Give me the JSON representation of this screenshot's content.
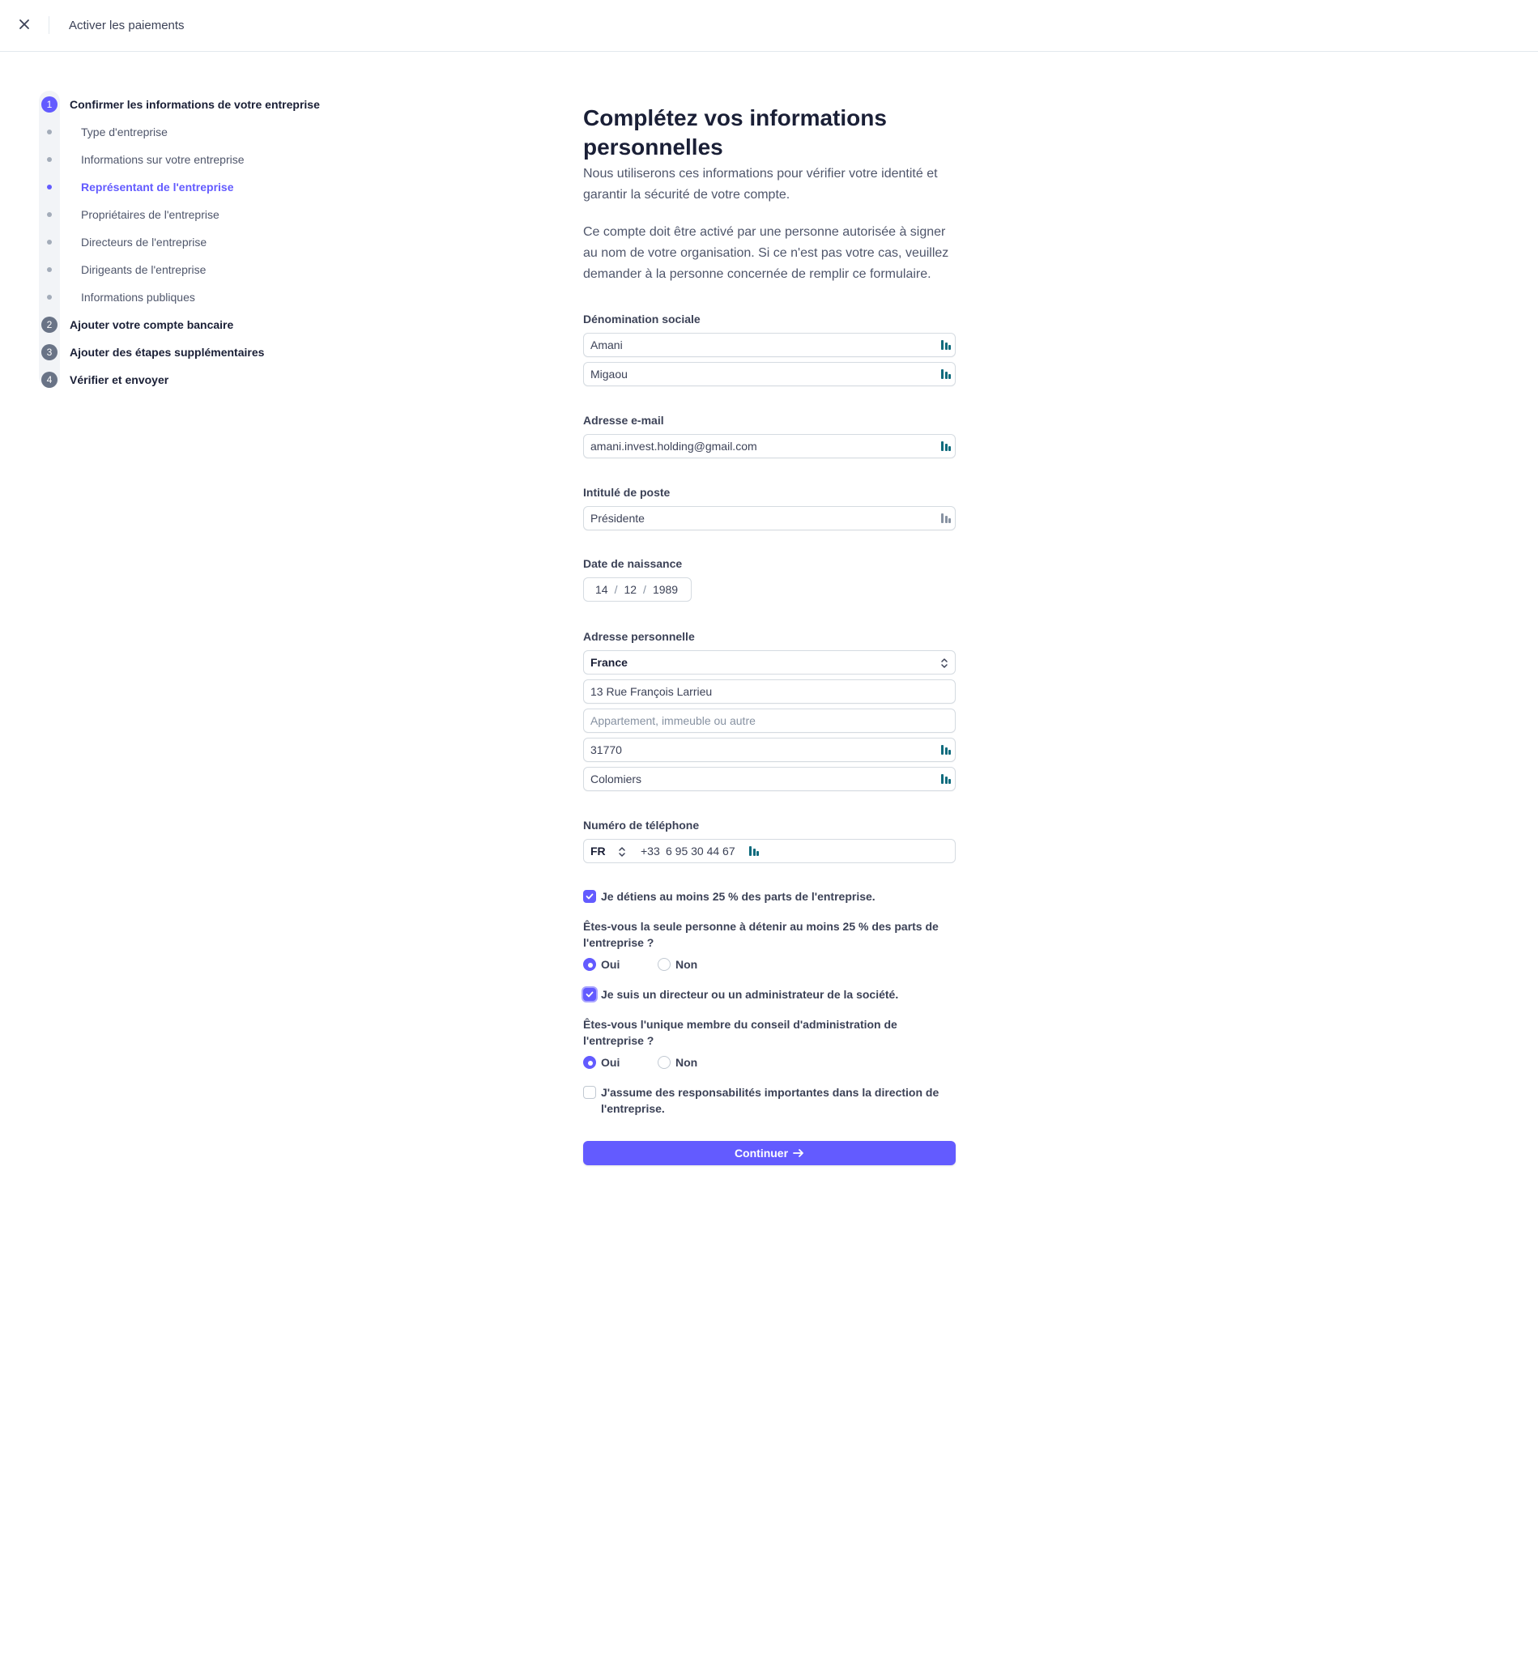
{
  "topbar": {
    "title": "Activer les paiements"
  },
  "stepper": {
    "steps": [
      {
        "num": "1",
        "label": "Confirmer les informations de votre entreprise"
      },
      {
        "num": "2",
        "label": "Ajouter votre compte bancaire"
      },
      {
        "num": "3",
        "label": "Ajouter des étapes supplémentaires"
      },
      {
        "num": "4",
        "label": "Vérifier et envoyer"
      }
    ],
    "substeps": [
      "Type d'entreprise",
      "Informations sur votre entreprise",
      "Représentant de l'entreprise",
      "Propriétaires de l'entreprise",
      "Directeurs de l'entreprise",
      "Dirigeants de l'entreprise",
      "Informations publiques"
    ],
    "active_substep": "Représentant de l'entreprise"
  },
  "form": {
    "heading_line1": "Complétez vos informations",
    "heading_line2": "personnelles",
    "intro_line1": "Nous utiliserons ces informations pour vérifier votre identité et",
    "intro_line2": "garantir la sécurité de votre compte.",
    "note_line1": "Ce compte doit être activé par une personne autorisée à signer",
    "note_line2": "au nom de votre organisation. Si ce n'est pas votre cas, veuillez",
    "note_line3": "demander à la personne concernée de remplir ce formulaire.",
    "name": {
      "label": "Dénomination sociale",
      "first": "Amani",
      "last": "Migaou"
    },
    "email": {
      "label": "Adresse e-mail",
      "value": "amani.invest.holding@gmail.com"
    },
    "job": {
      "label": "Intitulé de poste",
      "value": "Présidente"
    },
    "dob": {
      "label": "Date de naissance",
      "day": "14",
      "month": "12",
      "year": "1989",
      "sep": "/"
    },
    "address": {
      "label": "Adresse personnelle",
      "country": "France",
      "line1": "13 Rue François Larrieu",
      "line2_placeholder": "Appartement, immeuble ou autre",
      "postal": "31770",
      "city": "Colomiers"
    },
    "phone": {
      "label": "Numéro de téléphone",
      "country": "FR",
      "code": "+33",
      "number": "6 95 30 44 67"
    },
    "owner_check": {
      "label": "Je détiens au moins 25 % des parts de l'entreprise.",
      "checked": true
    },
    "owner_question": {
      "line1": "Êtes-vous la seule personne à détenir au moins 25 % des parts de",
      "line2": "l'entreprise ?",
      "yes": "Oui",
      "no": "Non",
      "selected": "Oui"
    },
    "director_check": {
      "label": "Je suis un directeur ou un administrateur de la société.",
      "checked": true
    },
    "board_question": {
      "line1": "Êtes-vous l'unique membre du conseil d'administration de",
      "line2": "l'entreprise ?",
      "yes": "Oui",
      "no": "Non",
      "selected": "Oui"
    },
    "exec_check": {
      "line1": "J'assume des responsabilités importantes dans la direction de",
      "line2": "l'entreprise.",
      "checked": false
    },
    "continue_label": "Continuer"
  },
  "colors": {
    "accent": "#635bff",
    "autofill_icon": "#0e6b7d"
  },
  "icons": [
    "close-icon",
    "autofill-icon",
    "updown-chevron-icon",
    "check-icon",
    "arrow-right-icon"
  ]
}
